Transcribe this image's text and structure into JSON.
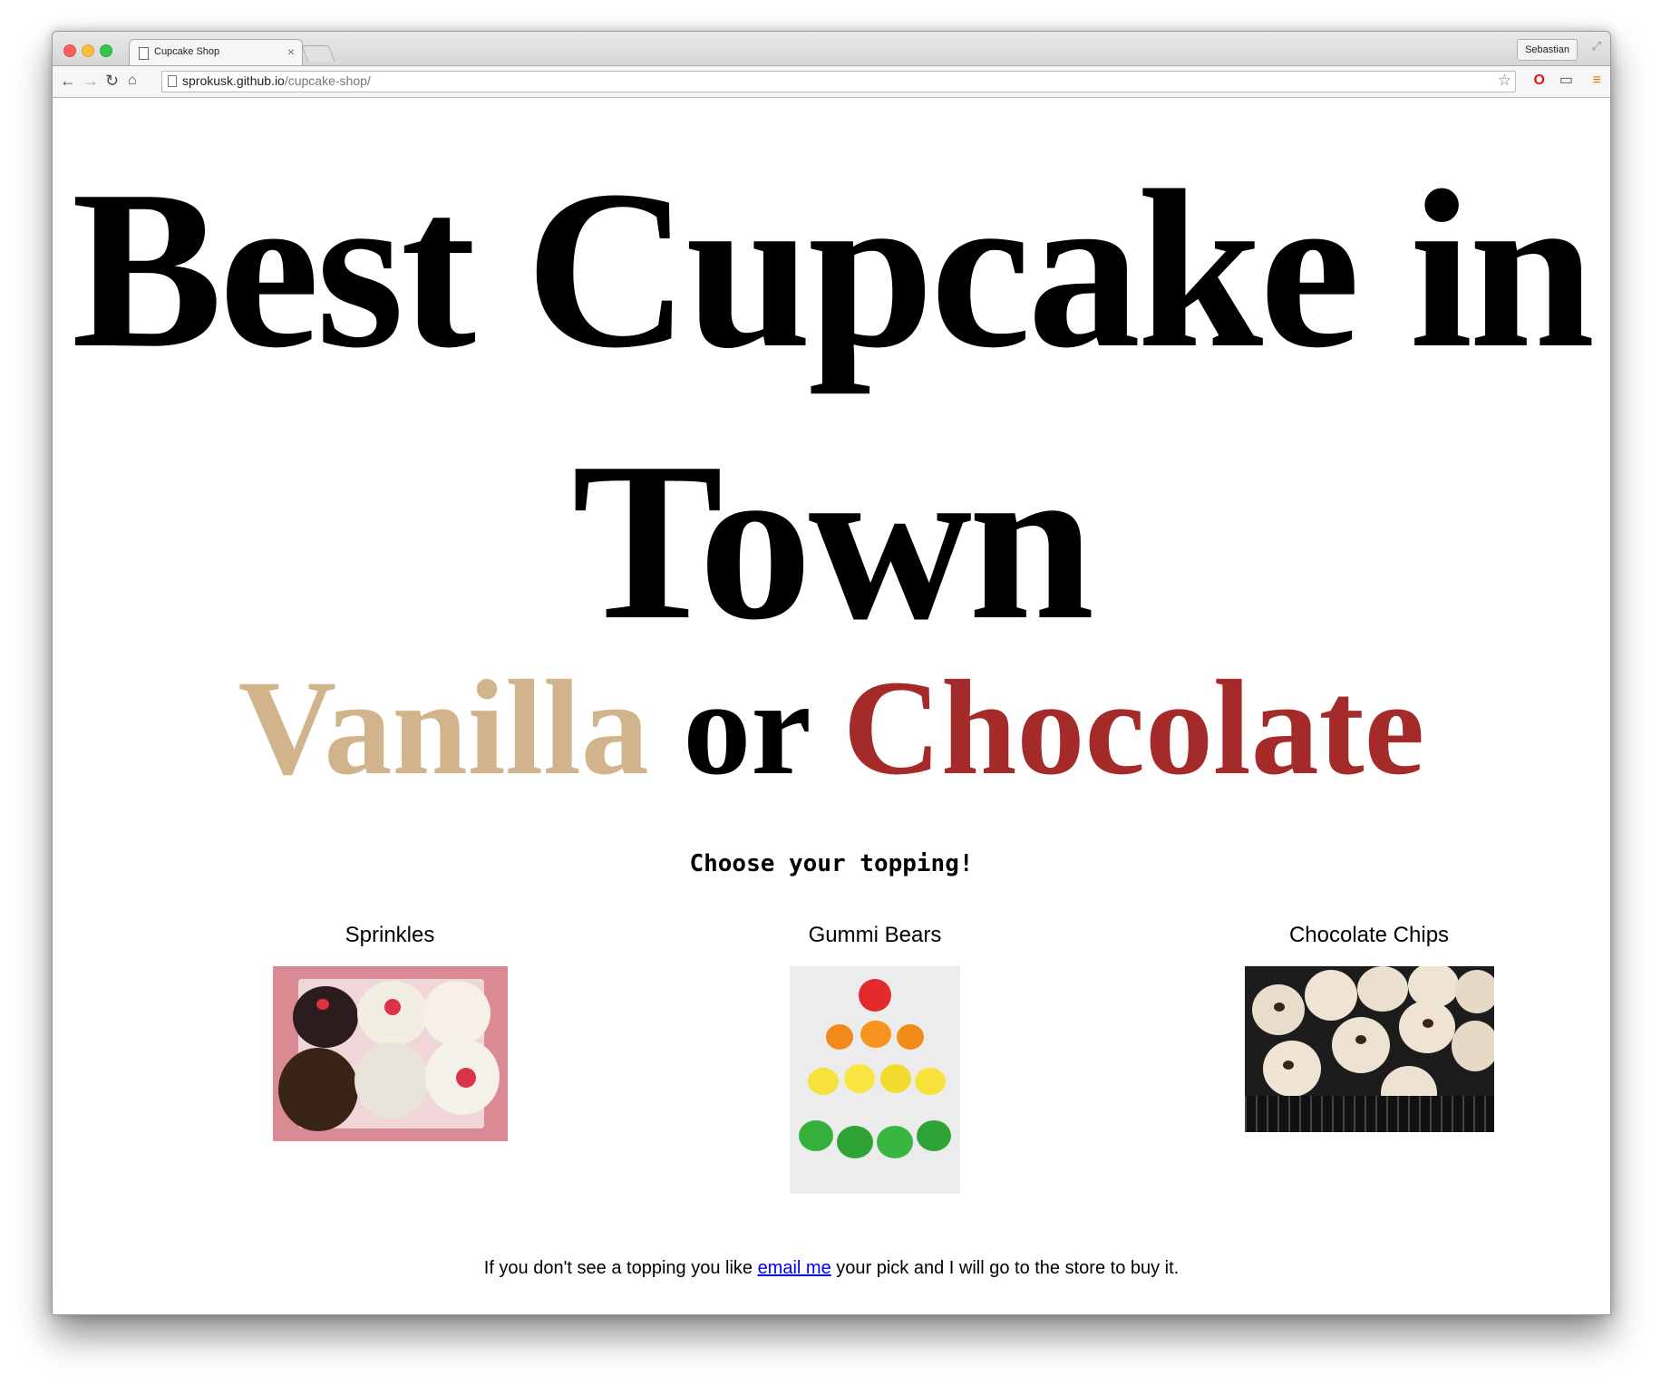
{
  "browser": {
    "tab_title": "Cupcake Shop",
    "tab_close": "×",
    "profile_name": "Sebastian",
    "url_host": "sprokusk.github.io",
    "url_path": "/cupcake-shop/"
  },
  "page": {
    "title": "Best Cupcake in Town",
    "flavor_vanilla": "Vanilla",
    "flavor_or": "or",
    "flavor_chocolate": "Chocolate",
    "choose_prompt": "Choose your topping!",
    "toppings": [
      {
        "name": "Sprinkles"
      },
      {
        "name": "Gummi Bears"
      },
      {
        "name": "Chocolate Chips"
      }
    ],
    "footer_before": "If you don't see a topping you like ",
    "footer_link": "email me",
    "footer_after": " your pick and I will go to the store to buy it."
  },
  "colors": {
    "vanilla": "#d2b48c",
    "chocolate": "#a52a2a",
    "link": "#0000ee"
  }
}
